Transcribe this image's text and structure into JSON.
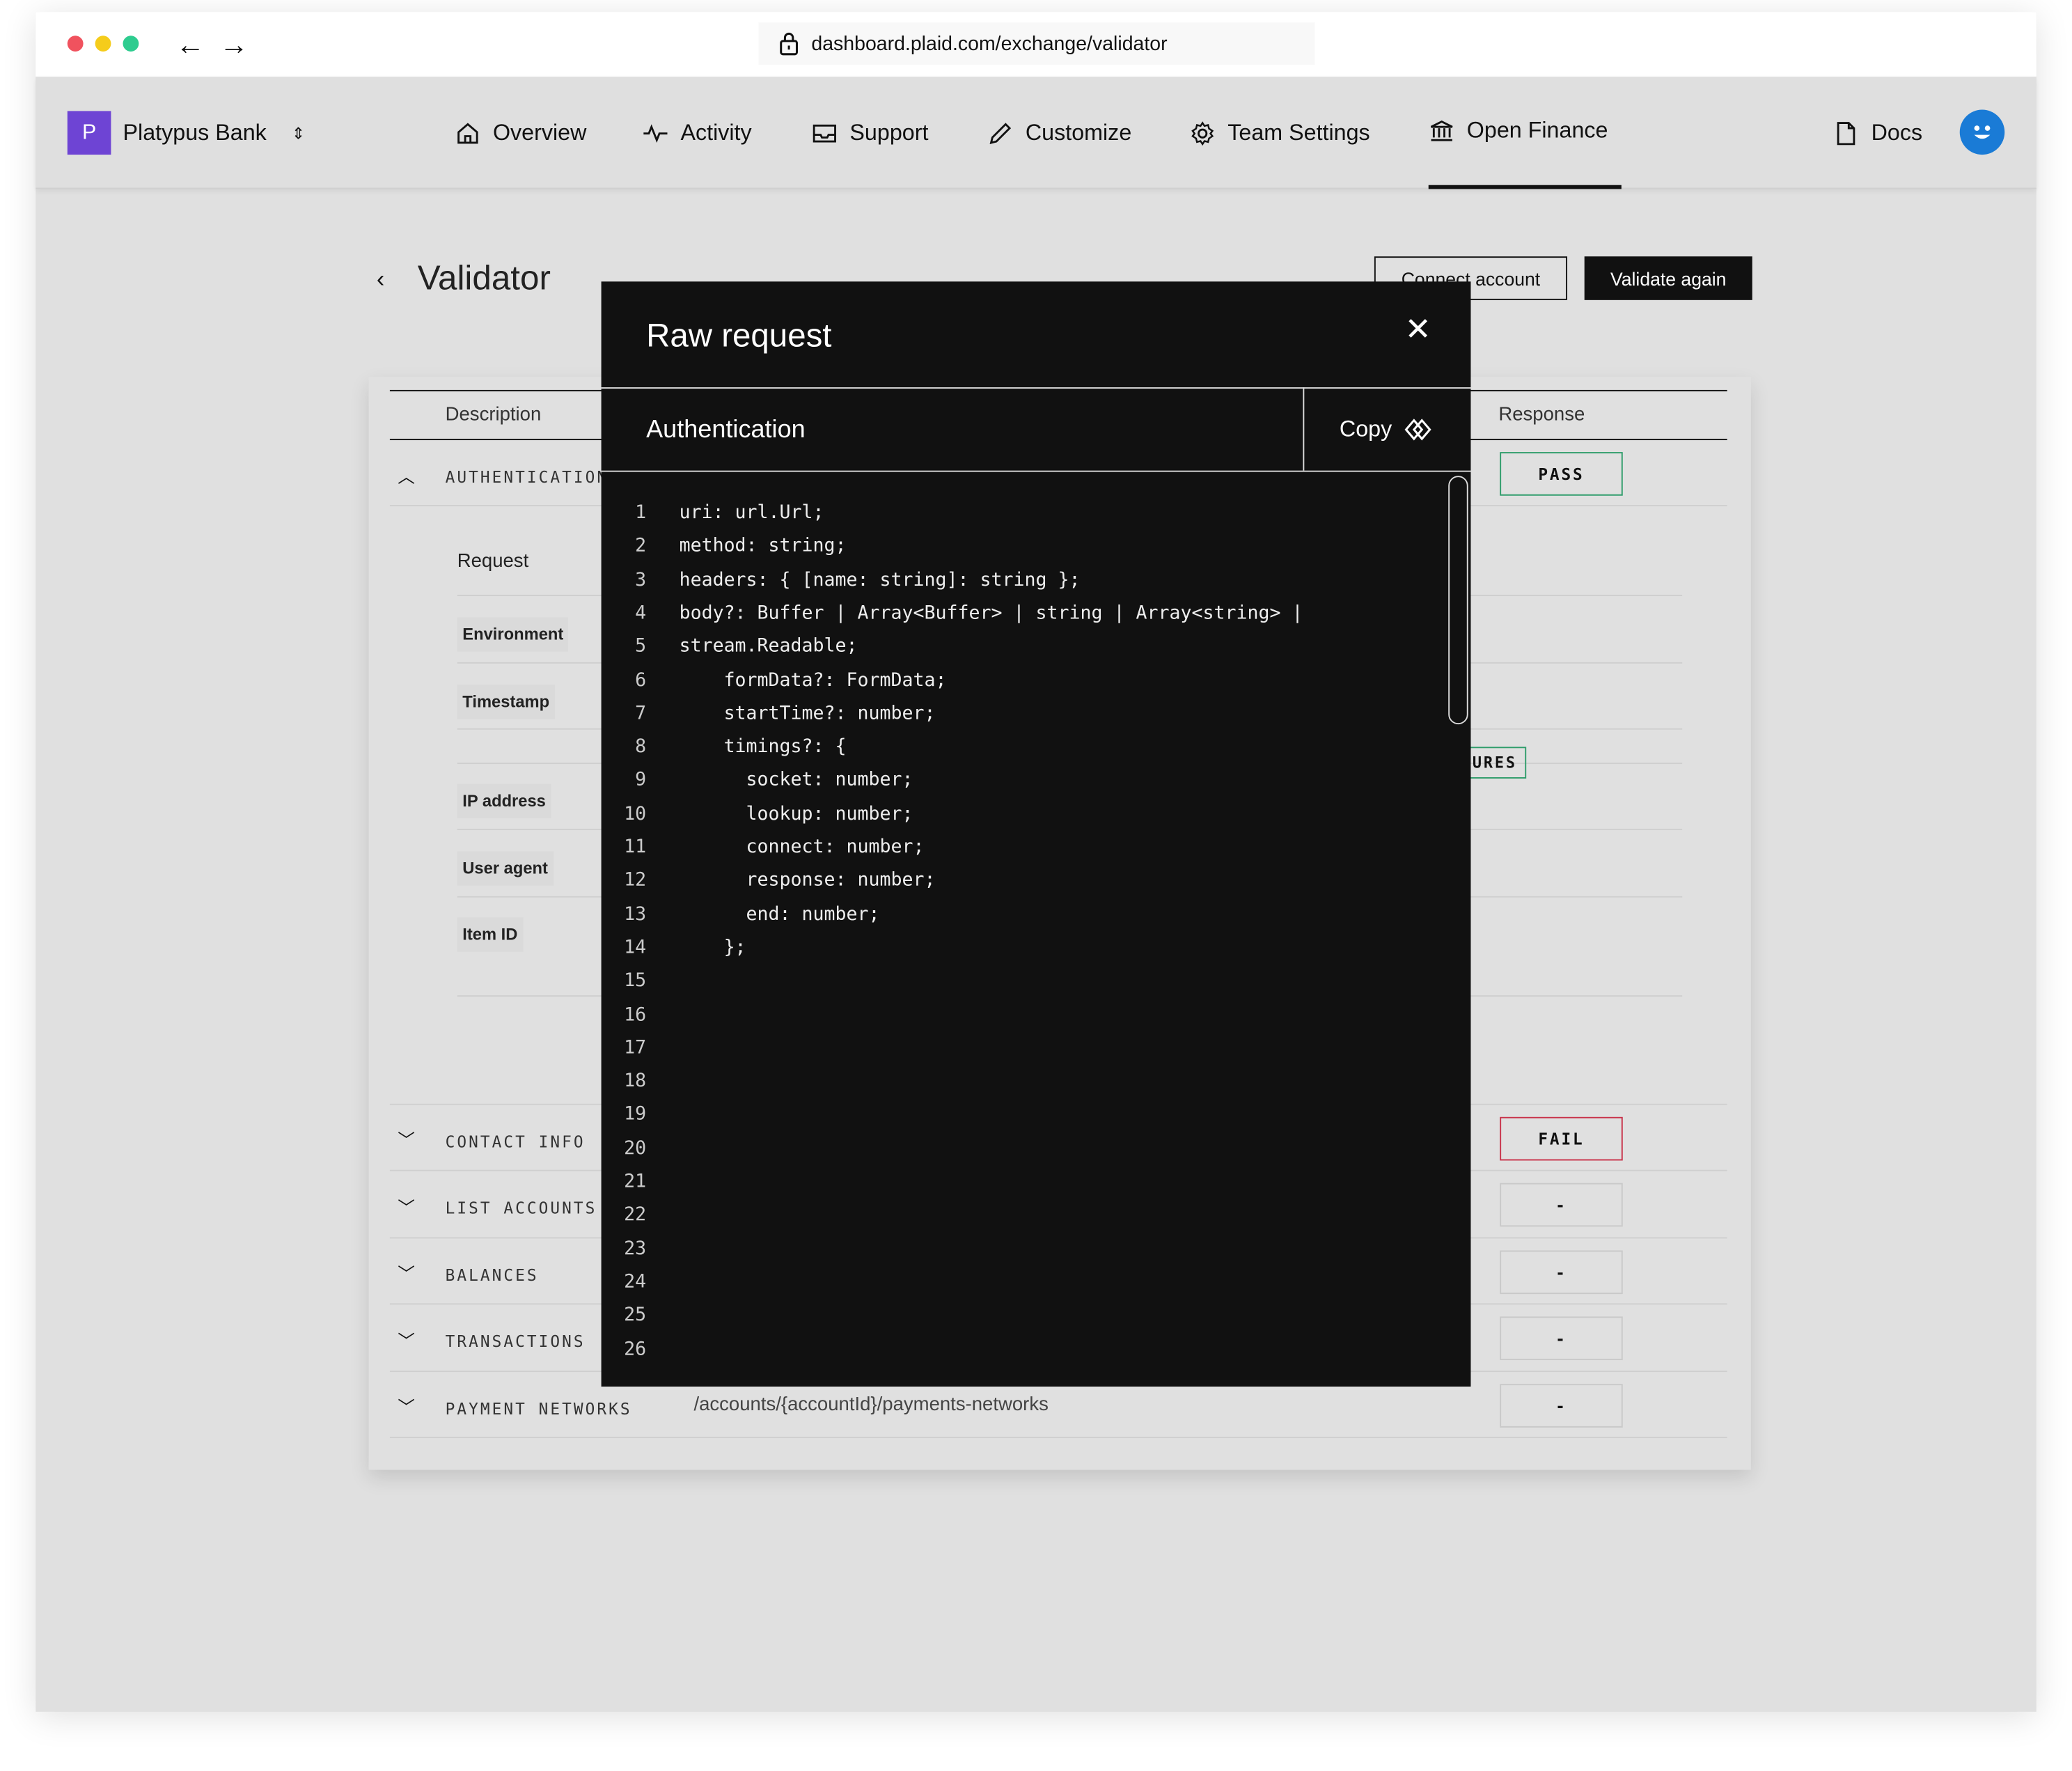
{
  "browser": {
    "url": "dashboard.plaid.com/exchange/validator",
    "traffic_colors": [
      "#f0525e",
      "#f5cc1b",
      "#2ecc8f"
    ]
  },
  "nav": {
    "org_initial": "P",
    "org_name": "Platypus Bank",
    "org_color": "#6e44d4",
    "items": [
      {
        "label": "Overview",
        "icon": "home-icon"
      },
      {
        "label": "Activity",
        "icon": "activity-icon"
      },
      {
        "label": "Support",
        "icon": "inbox-icon"
      },
      {
        "label": "Customize",
        "icon": "pencil-icon"
      },
      {
        "label": "Team Settings",
        "icon": "gear-icon"
      },
      {
        "label": "Open Finance",
        "icon": "bank-icon",
        "active": true
      }
    ],
    "docs": "Docs",
    "avatar_color": "#1a7bd6"
  },
  "page": {
    "title": "Validator",
    "connect_button": "Connect account",
    "validate_button": "Validate again"
  },
  "table": {
    "headers": {
      "description": "Description",
      "response": "Response"
    },
    "auth": {
      "label": "AUTHENTICATION",
      "status": "PASS",
      "sub_heading": "Request",
      "fields": [
        "Environment",
        "Timestamp",
        "IP address",
        "User agent",
        "Item ID"
      ],
      "partial_badge": "URES"
    },
    "sections": [
      {
        "label": "CONTACT INFO",
        "status": "FAIL"
      },
      {
        "label": "LIST ACCOUNTS",
        "status": "-"
      },
      {
        "label": "BALANCES",
        "status": "-"
      },
      {
        "label": "TRANSACTIONS",
        "status": "-"
      },
      {
        "label": "PAYMENT NETWORKS",
        "status": "-",
        "endpoint": "/accounts/{accountId}/payments-networks"
      }
    ],
    "pass_color": "#2e9c6a",
    "fail_color": "#c8324a"
  },
  "modal": {
    "title": "Raw request",
    "tab": "Authentication",
    "copy": "Copy",
    "lines": [
      "uri: url.Url;",
      "method: string;",
      "headers: { [name: string]: string };",
      "body?: Buffer | Array<Buffer> | string | Array<string> |",
      "stream.Readable;",
      "    formData?: FormData;",
      "    startTime?: number;",
      "    timings?: {",
      "      socket: number;",
      "      lookup: number;",
      "      connect: number;",
      "      response: number;",
      "      end: number;",
      "    };",
      "",
      "",
      "",
      "",
      "",
      "",
      "",
      "",
      "",
      "",
      "",
      ""
    ]
  }
}
